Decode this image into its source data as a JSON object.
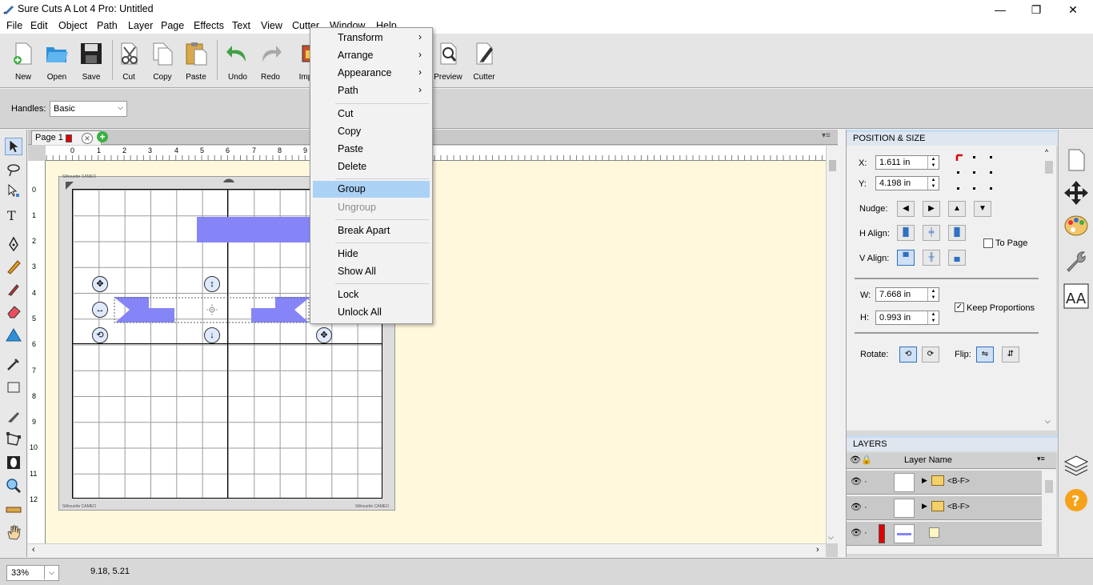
{
  "window": {
    "title": "Sure Cuts A Lot 4 Pro: Untitled",
    "min": "—",
    "max": "❐",
    "close": "✕"
  },
  "menubar": [
    "File",
    "Edit",
    "Object",
    "Path",
    "Layer",
    "Page",
    "Effects",
    "Text",
    "View",
    "Cutter",
    "Window",
    "Help"
  ],
  "toolbar": {
    "new": "New",
    "open": "Open",
    "save": "Save",
    "cut": "Cut",
    "copy": "Copy",
    "paste": "Paste",
    "undo": "Undo",
    "redo": "Redo",
    "import": "Imp",
    "preview": "Preview",
    "cutter": "Cutter"
  },
  "handles": {
    "label": "Handles:",
    "value": "Basic"
  },
  "tabs": {
    "page": "Page 1"
  },
  "ruler": {
    "h": [
      "0",
      "1",
      "2",
      "3",
      "4",
      "5",
      "6",
      "7",
      "8",
      "9"
    ],
    "v": [
      "0",
      "1",
      "2",
      "3",
      "4",
      "5",
      "6",
      "7",
      "8",
      "9",
      "10",
      "11",
      "12"
    ]
  },
  "mat": {
    "brand_left_top": "Silhouette CAMEO",
    "brand_left_bottom": "Silhouette CAMEO",
    "brand_right_bottom": "Silhouette CAMEO"
  },
  "context_menu": {
    "transform": "Transform",
    "arrange": "Arrange",
    "appearance": "Appearance",
    "path": "Path",
    "cut": "Cut",
    "copy": "Copy",
    "paste": "Paste",
    "delete": "Delete",
    "group": "Group",
    "ungroup": "Ungroup",
    "break_apart": "Break Apart",
    "hide": "Hide",
    "show_all": "Show All",
    "lock": "Lock",
    "unlock_all": "Unlock All"
  },
  "position_size": {
    "header": "POSITION & SIZE",
    "x_label": "X:",
    "x_value": "1.611 in",
    "y_label": "Y:",
    "y_value": "4.198 in",
    "nudge": "Nudge:",
    "h_align": "H Align:",
    "v_align": "V Align:",
    "to_page": "To Page",
    "w_label": "W:",
    "w_value": "7.668 in",
    "h_label": "H:",
    "h_value": "0.993 in",
    "keep_proportions": "Keep Proportions",
    "rotate": "Rotate:",
    "flip": "Flip:"
  },
  "layers": {
    "header": "LAYERS",
    "column": "Layer Name",
    "rows": [
      {
        "name": "<B-F>"
      },
      {
        "name": "<B-F>"
      },
      {
        "name": ""
      }
    ]
  },
  "status": {
    "zoom": "33%",
    "coords": "9.18, 5.21"
  },
  "colors": {
    "shape": "#8585f7",
    "highlight": "#abd2f5",
    "workspace": "#fff8dc",
    "panel_header": "#c4ddf4"
  }
}
